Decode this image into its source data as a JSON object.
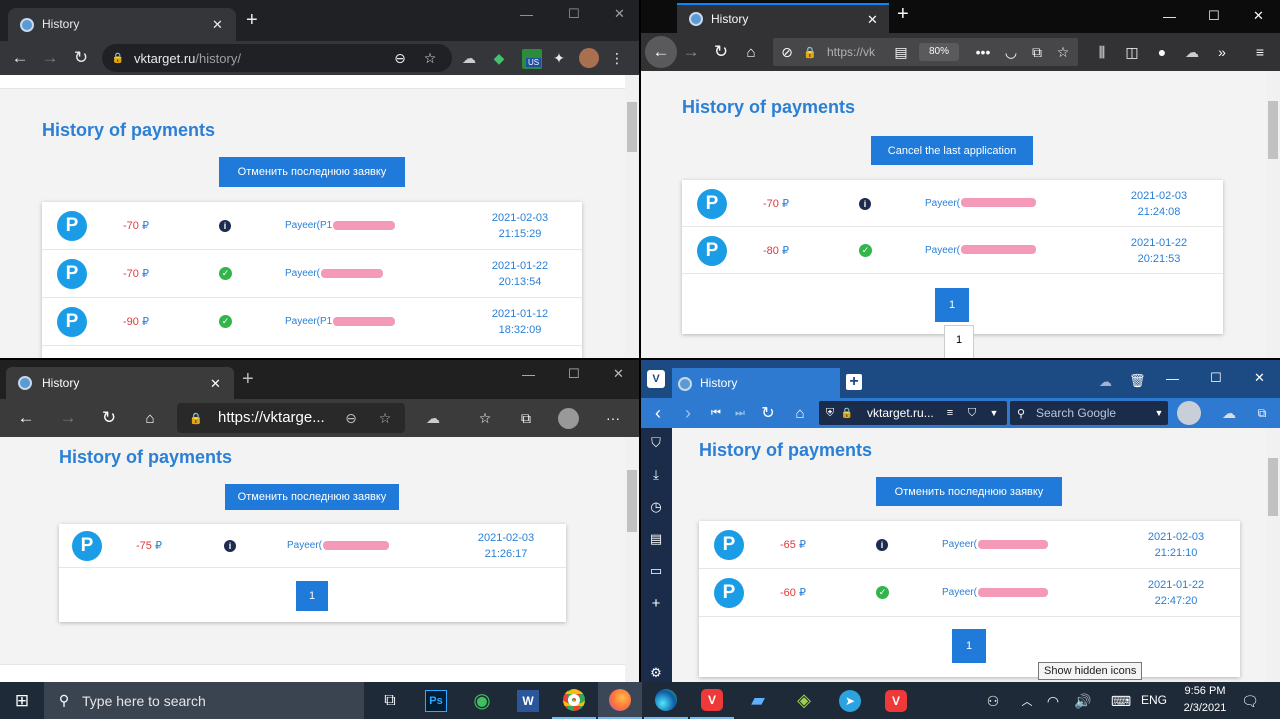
{
  "page_heading": "History of payments",
  "ruble": "₽",
  "chrome": {
    "tab_title": "History",
    "url_host": "vktarget.ru",
    "url_path": "/history/",
    "cancel_button": "Отменить последнюю заявку",
    "rows": [
      {
        "amount": "-70",
        "status": "info",
        "payee": "Payeer(P1",
        "date": "2021-02-03",
        "time": "21:15:29"
      },
      {
        "amount": "-70",
        "status": "ok",
        "payee": "Payeer(",
        "date": "2021-01-22",
        "time": "20:13:54"
      },
      {
        "amount": "-90",
        "status": "ok",
        "payee": "Payeer(P1",
        "date": "2021-01-12",
        "time": "18:32:09"
      }
    ],
    "ext_badge": "US"
  },
  "firefox": {
    "tab_title": "History",
    "url": "https://vk",
    "zoom": "80%",
    "cancel_button": "Cancel the last application",
    "rows": [
      {
        "amount": "-70",
        "status": "info",
        "payee": "Payeer(",
        "date": "2021-02-03",
        "time": "21:24:08"
      },
      {
        "amount": "-80",
        "status": "ok",
        "payee": "Payeer(",
        "date": "2021-01-22",
        "time": "20:21:53"
      }
    ],
    "page_number": "1",
    "page_tooltip": "1"
  },
  "edge": {
    "tab_title": "History",
    "url": "https://vktarge...",
    "cancel_button": "Отменить последнюю заявку",
    "rows": [
      {
        "amount": "-75",
        "status": "info",
        "payee": "Payeer(",
        "date": "2021-02-03",
        "time": "21:26:17"
      }
    ],
    "page_number": "1"
  },
  "vivaldi": {
    "tab_title": "History",
    "url": "vktarget.ru...",
    "search_placeholder": "Search Google",
    "cancel_button": "Отменить последнюю заявку",
    "rows": [
      {
        "amount": "-65",
        "status": "info",
        "payee": "Payeer(",
        "date": "2021-02-03",
        "time": "21:21:10"
      },
      {
        "amount": "-60",
        "status": "ok",
        "payee": "Payeer(",
        "date": "2021-01-22",
        "time": "22:47:20"
      }
    ],
    "page_number": "1",
    "tooltip": "Show hidden icons"
  },
  "taskbar": {
    "search_placeholder": "Type here to search",
    "language": "ENG",
    "time": "9:56 PM",
    "date": "2/3/2021",
    "ps_label": "Ps",
    "word_label": "W"
  }
}
